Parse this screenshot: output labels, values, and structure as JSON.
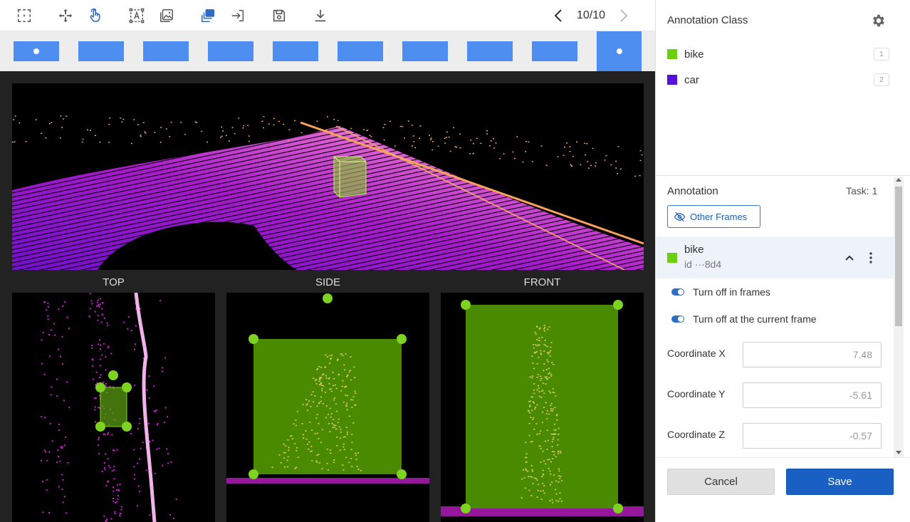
{
  "toolbar": {
    "tools": [
      {
        "name": "select-region-icon"
      },
      {
        "name": "move-icon"
      },
      {
        "name": "touch-pointer-icon"
      },
      {
        "name": "text-annotation-icon"
      },
      {
        "name": "image-icon"
      },
      {
        "name": "layers-icon"
      },
      {
        "name": "export-arrow-icon"
      },
      {
        "name": "save-disk-icon"
      },
      {
        "name": "download-icon"
      }
    ],
    "frame_counter": "10/10"
  },
  "timeline": {
    "frames": [
      {
        "index": 1,
        "has_annotation": true
      },
      {
        "index": 2,
        "has_annotation": false
      },
      {
        "index": 3,
        "has_annotation": false
      },
      {
        "index": 4,
        "has_annotation": false
      },
      {
        "index": 5,
        "has_annotation": false
      },
      {
        "index": 6,
        "has_annotation": false
      },
      {
        "index": 7,
        "has_annotation": false
      },
      {
        "index": 8,
        "has_annotation": false
      },
      {
        "index": 9,
        "has_annotation": false
      },
      {
        "index": 10,
        "has_annotation": true,
        "current": true
      }
    ],
    "color": "#4d8ef0"
  },
  "views": {
    "top_label": "TOP",
    "side_label": "SIDE",
    "front_label": "FRONT",
    "box_color": "#4a8a00",
    "handle_color": "#7ed321"
  },
  "annotation_class": {
    "title": "Annotation Class",
    "classes": [
      {
        "name": "bike",
        "color": "#6bcf0d",
        "hotkey": "1"
      },
      {
        "name": "car",
        "color": "#5512d9",
        "hotkey": "2"
      }
    ]
  },
  "annotation": {
    "title": "Annotation",
    "task_label": "Task: 1",
    "other_frames_label": "Other Frames",
    "item": {
      "name": "bike",
      "id": "id ···8d4",
      "color": "#6bcf0d"
    },
    "toggles": [
      {
        "label": "Turn off in frames",
        "on": true
      },
      {
        "label": "Turn off at the current frame",
        "on": true
      }
    ],
    "coordinates": [
      {
        "label": "Coordinate X",
        "value": "7.48"
      },
      {
        "label": "Coordinate Y",
        "value": "-5.61"
      },
      {
        "label": "Coordinate Z",
        "value": "-0.57"
      }
    ]
  },
  "footer": {
    "cancel_label": "Cancel",
    "save_label": "Save"
  }
}
